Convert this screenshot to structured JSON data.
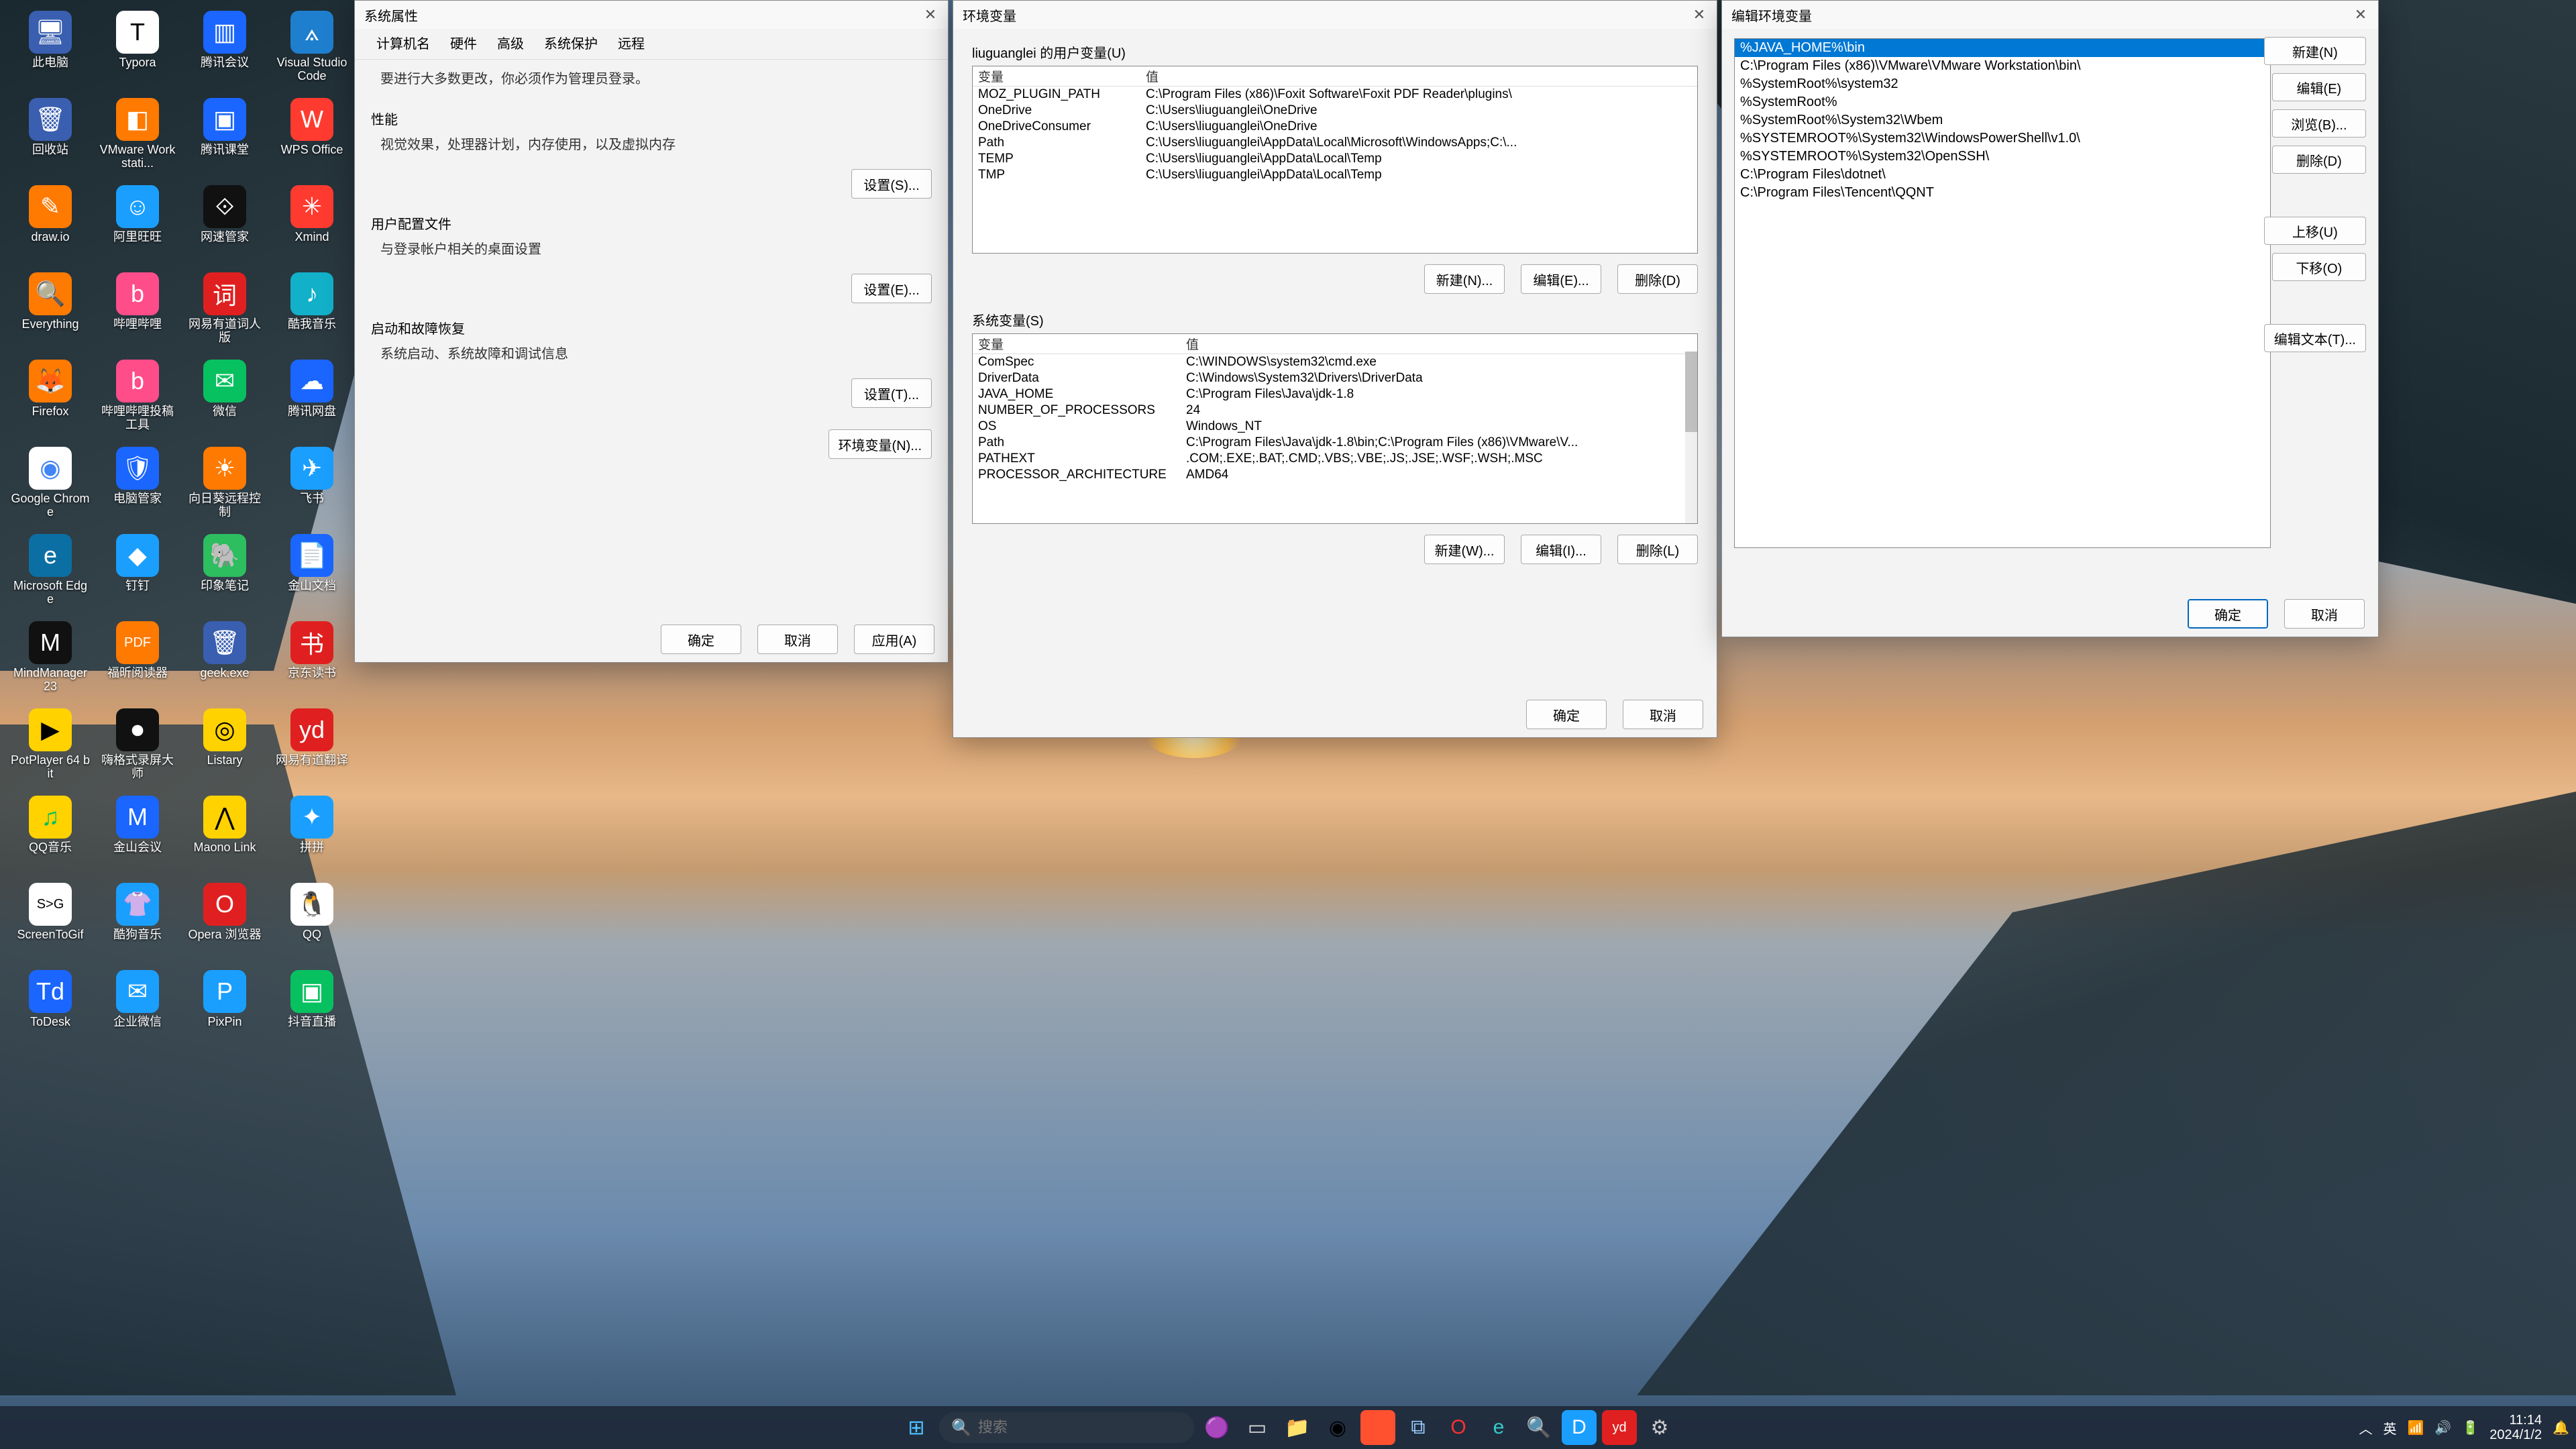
{
  "desktop_icons": [
    {
      "label": "此电脑",
      "bg": "#3a5fb0",
      "glyph": "🖥"
    },
    {
      "label": "Typora",
      "bg": "#ffffff",
      "glyph": "T",
      "fg": "#000"
    },
    {
      "label": "腾讯会议",
      "bg": "#1a66ff",
      "glyph": "▥"
    },
    {
      "label": "Visual Studio Code",
      "bg": "#1f7fcf",
      "glyph": "⟑"
    },
    {
      "label": "回收站",
      "bg": "#3a5fb0",
      "glyph": "🗑"
    },
    {
      "label": "VMware Workstati...",
      "bg": "#ff7a00",
      "glyph": "◧"
    },
    {
      "label": "腾讯课堂",
      "bg": "#1a66ff",
      "glyph": "▣"
    },
    {
      "label": "WPS Office",
      "bg": "#ff3b30",
      "glyph": "W"
    },
    {
      "label": "draw.io",
      "bg": "#ff7a00",
      "glyph": "✎"
    },
    {
      "label": "阿里旺旺",
      "bg": "#1a9fff",
      "glyph": "☺"
    },
    {
      "label": "网速管家",
      "bg": "#111",
      "glyph": "⟐"
    },
    {
      "label": "Xmind",
      "bg": "#ff3b30",
      "glyph": "✳"
    },
    {
      "label": "Everything",
      "bg": "#ff7a00",
      "glyph": "🔍"
    },
    {
      "label": "哔哩哔哩",
      "bg": "#ff4d8a",
      "glyph": "b"
    },
    {
      "label": "网易有道词人版",
      "bg": "#e02020",
      "glyph": "词"
    },
    {
      "label": "酷我音乐",
      "bg": "#12b0c9",
      "glyph": "♪"
    },
    {
      "label": "Firefox",
      "bg": "#ff7a00",
      "glyph": "🦊"
    },
    {
      "label": "哔哩哔哩投稿工具",
      "bg": "#ff4d8a",
      "glyph": "b"
    },
    {
      "label": "微信",
      "bg": "#07c160",
      "glyph": "✉"
    },
    {
      "label": "腾讯网盘",
      "bg": "#1a66ff",
      "glyph": "☁"
    },
    {
      "label": "Google Chrome",
      "bg": "#ffffff",
      "glyph": "◉",
      "fg": "#4285f4"
    },
    {
      "label": "电脑管家",
      "bg": "#1a66ff",
      "glyph": "🛡"
    },
    {
      "label": "向日葵远程控制",
      "bg": "#ff7a00",
      "glyph": "☀"
    },
    {
      "label": "飞书",
      "bg": "#1a9fff",
      "glyph": "✈"
    },
    {
      "label": "Microsoft Edge",
      "bg": "#0b6fa4",
      "glyph": "e"
    },
    {
      "label": "钉钉",
      "bg": "#1a9fff",
      "glyph": "◆"
    },
    {
      "label": "印象笔记",
      "bg": "#2dbe60",
      "glyph": "🐘"
    },
    {
      "label": "金山文档",
      "bg": "#1a66ff",
      "glyph": "📄"
    },
    {
      "label": "MindManager 23",
      "bg": "#111",
      "glyph": "M"
    },
    {
      "label": "福昕阅读器",
      "bg": "#ff7a00",
      "glyph": "PDF"
    },
    {
      "label": "geek.exe",
      "bg": "#3a5fb0",
      "glyph": "🗑"
    },
    {
      "label": "京东读书",
      "bg": "#e02020",
      "glyph": "书"
    },
    {
      "label": "PotPlayer 64 bit",
      "bg": "#ffd200",
      "glyph": "▶",
      "fg": "#000"
    },
    {
      "label": "嗨格式录屏大师",
      "bg": "#111",
      "glyph": "⏺"
    },
    {
      "label": "Listary",
      "bg": "#ffd200",
      "glyph": "◎",
      "fg": "#000"
    },
    {
      "label": "网易有道翻译",
      "bg": "#e02020",
      "glyph": "yd"
    },
    {
      "label": "QQ音乐",
      "bg": "#ffd200",
      "glyph": "♫",
      "fg": "#07c160"
    },
    {
      "label": "金山会议",
      "bg": "#1a66ff",
      "glyph": "M"
    },
    {
      "label": "Maono Link",
      "bg": "#ffd200",
      "glyph": "⋀",
      "fg": "#000"
    },
    {
      "label": "拼拼",
      "bg": "#1a9fff",
      "glyph": "✦"
    },
    {
      "label": "ScreenToGif",
      "bg": "#ffffff",
      "glyph": "S>G",
      "fg": "#000"
    },
    {
      "label": "酷狗音乐",
      "bg": "#1a9fff",
      "glyph": "👚"
    },
    {
      "label": "Opera 浏览器",
      "bg": "#e02020",
      "glyph": "O"
    },
    {
      "label": "QQ",
      "bg": "#ffffff",
      "glyph": "🐧",
      "fg": "#000"
    },
    {
      "label": "ToDesk",
      "bg": "#1a66ff",
      "glyph": "Td"
    },
    {
      "label": "企业微信",
      "bg": "#1a9fff",
      "glyph": "✉"
    },
    {
      "label": "PixPin",
      "bg": "#1a9fff",
      "glyph": "P"
    },
    {
      "label": "抖音直播",
      "bg": "#07c160",
      "glyph": "▣"
    }
  ],
  "win1": {
    "title": "系统属性",
    "tabs": [
      "计算机名",
      "硬件",
      "高级",
      "系统保护",
      "远程"
    ],
    "active_tab": 2,
    "notice": "要进行大多数更改，你必须作为管理员登录。",
    "perf_h": "性能",
    "perf_p": "视觉效果，处理器计划，内存使用，以及虚拟内存",
    "perf_btn": "设置(S)...",
    "prof_h": "用户配置文件",
    "prof_p": "与登录帐户相关的桌面设置",
    "prof_btn": "设置(E)...",
    "boot_h": "启动和故障恢复",
    "boot_p": "系统启动、系统故障和调试信息",
    "boot_btn": "设置(T)...",
    "env_btn": "环境变量(N)...",
    "ok": "确定",
    "cancel": "取消",
    "apply": "应用(A)"
  },
  "win2": {
    "title": "环境变量",
    "user_h": "liuguanglei 的用户变量(U)",
    "col_var": "变量",
    "col_val": "值",
    "user_vars": [
      {
        "n": "MOZ_PLUGIN_PATH",
        "v": "C:\\Program Files (x86)\\Foxit Software\\Foxit PDF Reader\\plugins\\"
      },
      {
        "n": "OneDrive",
        "v": "C:\\Users\\liuguanglei\\OneDrive"
      },
      {
        "n": "OneDriveConsumer",
        "v": "C:\\Users\\liuguanglei\\OneDrive"
      },
      {
        "n": "Path",
        "v": "C:\\Users\\liuguanglei\\AppData\\Local\\Microsoft\\WindowsApps;C:\\..."
      },
      {
        "n": "TEMP",
        "v": "C:\\Users\\liuguanglei\\AppData\\Local\\Temp"
      },
      {
        "n": "TMP",
        "v": "C:\\Users\\liuguanglei\\AppData\\Local\\Temp"
      }
    ],
    "new_u": "新建(N)...",
    "edit_u": "编辑(E)...",
    "del_u": "删除(D)",
    "sys_h": "系统变量(S)",
    "sys_vars": [
      {
        "n": "ComSpec",
        "v": "C:\\WINDOWS\\system32\\cmd.exe"
      },
      {
        "n": "DriverData",
        "v": "C:\\Windows\\System32\\Drivers\\DriverData"
      },
      {
        "n": "JAVA_HOME",
        "v": "C:\\Program Files\\Java\\jdk-1.8"
      },
      {
        "n": "NUMBER_OF_PROCESSORS",
        "v": "24"
      },
      {
        "n": "OS",
        "v": "Windows_NT"
      },
      {
        "n": "Path",
        "v": "C:\\Program Files\\Java\\jdk-1.8\\bin;C:\\Program Files (x86)\\VMware\\V..."
      },
      {
        "n": "PATHEXT",
        "v": ".COM;.EXE;.BAT;.CMD;.VBS;.VBE;.JS;.JSE;.WSF;.WSH;.MSC"
      },
      {
        "n": "PROCESSOR_ARCHITECTURE",
        "v": "AMD64"
      }
    ],
    "new_s": "新建(W)...",
    "edit_s": "编辑(I)...",
    "del_s": "删除(L)",
    "ok": "确定",
    "cancel": "取消"
  },
  "win3": {
    "title": "编辑环境变量",
    "paths": [
      "%JAVA_HOME%\\bin",
      "C:\\Program Files (x86)\\VMware\\VMware Workstation\\bin\\",
      "%SystemRoot%\\system32",
      "%SystemRoot%",
      "%SystemRoot%\\System32\\Wbem",
      "%SYSTEMROOT%\\System32\\WindowsPowerShell\\v1.0\\",
      "%SYSTEMROOT%\\System32\\OpenSSH\\",
      "C:\\Program Files\\dotnet\\",
      "C:\\Program Files\\Tencent\\QQNT"
    ],
    "selected": 0,
    "new": "新建(N)",
    "edit": "编辑(E)",
    "browse": "浏览(B)...",
    "del": "删除(D)",
    "up": "上移(U)",
    "down": "下移(O)",
    "edit_text": "编辑文本(T)...",
    "ok": "确定",
    "cancel": "取消"
  },
  "taskbar": {
    "search_placeholder": "搜索",
    "ime": "英",
    "time": "11:14",
    "date": "2024/1/2"
  }
}
